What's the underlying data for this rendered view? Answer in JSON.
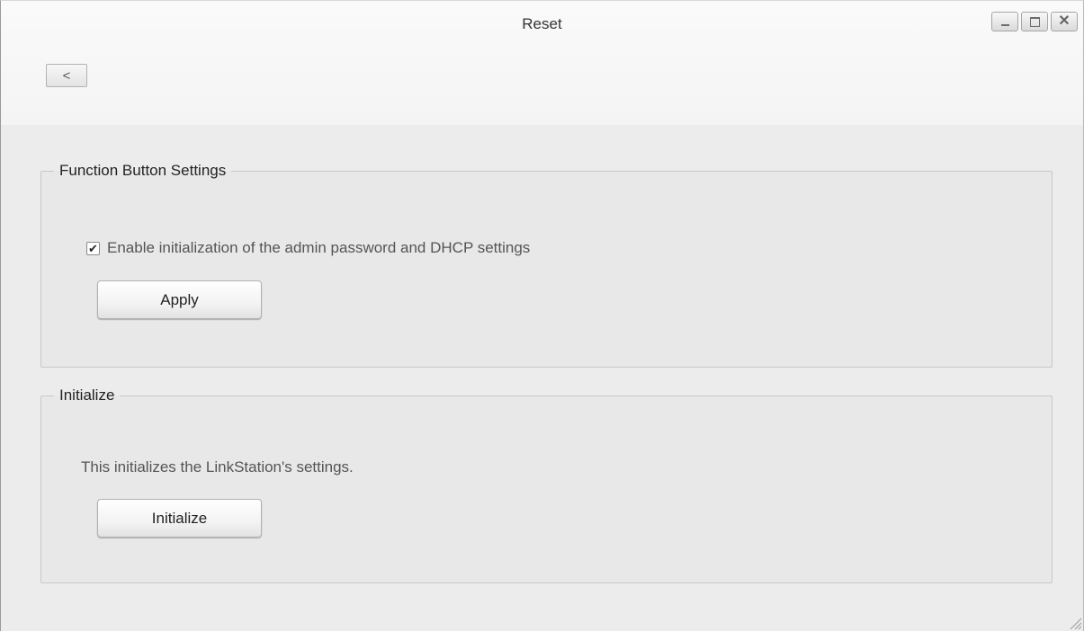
{
  "window": {
    "title": "Reset",
    "back_label": "<",
    "controls": {
      "minimize": "minimize-icon",
      "maximize": "maximize-icon",
      "close_glyph": "✕"
    }
  },
  "function_button_settings": {
    "legend": "Function Button Settings",
    "checkbox_label": "Enable initialization of the admin password and DHCP settings",
    "checkbox_checked": true,
    "apply_label": "Apply"
  },
  "initialize": {
    "legend": "Initialize",
    "description": "This initializes the LinkStation's settings.",
    "button_label": "Initialize"
  },
  "colors": {
    "window_bg": "#ececec",
    "header_bg": "#f4f4f4",
    "group_bg": "#e8e8e8",
    "border": "#c8c8c8"
  }
}
